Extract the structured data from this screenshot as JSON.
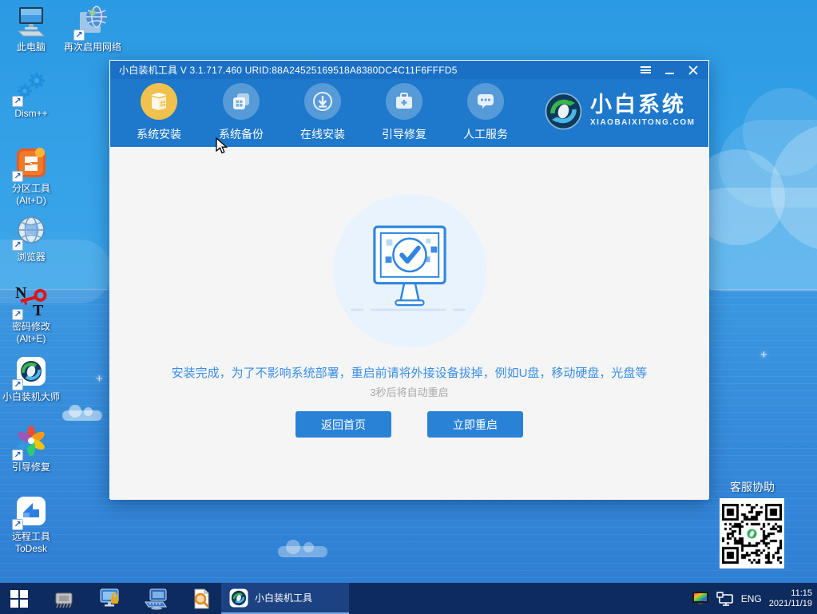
{
  "window": {
    "title": "小白装机工具 V 3.1.717.460 URID:88A24525169518A8380DC4C11F6FFFD5",
    "nav": {
      "tabs": [
        {
          "label": "系统安装",
          "active": true
        },
        {
          "label": "系统备份",
          "active": false
        },
        {
          "label": "在线安装",
          "active": false
        },
        {
          "label": "引导修复",
          "active": false
        },
        {
          "label": "人工服务",
          "active": false
        }
      ]
    },
    "brand": {
      "name": "小白系统",
      "site": "XIAOBAIXITONG.COM"
    },
    "main": {
      "message": "安装完成，为了不影响系统部署，重启前请将外接设备拔掉，例如U盘，移动硬盘，光盘等",
      "countdown": "3秒后将自动重启",
      "buttons": {
        "home": "返回首页",
        "restart": "立即重启"
      }
    }
  },
  "desktop": {
    "icons": [
      {
        "label": "此电脑"
      },
      {
        "label": "再次启用网络"
      },
      {
        "label": "Dism++"
      },
      {
        "label": "分区工具",
        "label2": "(Alt+D)"
      },
      {
        "label": "浏览器"
      },
      {
        "label": "密码修改",
        "label2": "(Alt+E)"
      },
      {
        "label": "小白装机大师"
      },
      {
        "label": "引导修复"
      },
      {
        "label": "远程工具",
        "label2": "ToDesk"
      }
    ],
    "qr_label": "客服协助"
  },
  "taskbar": {
    "active_task": "小白装机工具",
    "tray": {
      "language": "ENG",
      "time": "11:15",
      "date": "2021/11/19"
    }
  },
  "colors": {
    "titlebar_blue": "#1a70c4",
    "nav_blue": "#1e78cb",
    "accent_blue": "#2a82d6",
    "active_tab_yellow": "#f0c24d",
    "taskbar_navy": "#0d2b5e",
    "message_blue": "#3a8ee6"
  }
}
